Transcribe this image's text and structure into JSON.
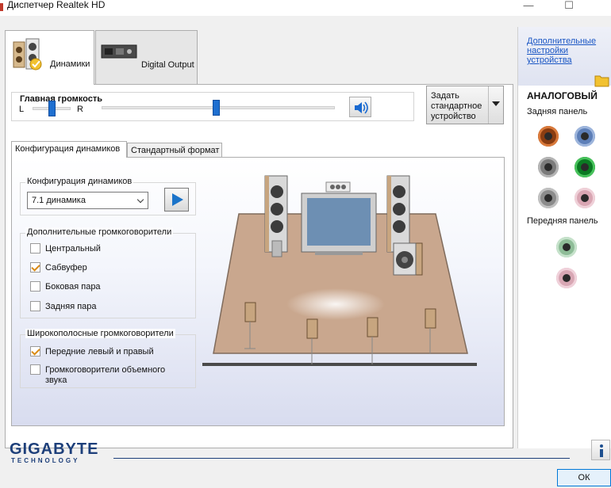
{
  "window": {
    "title": "Диспетчер Realtek HD",
    "minimize": "—",
    "maximize": "☐"
  },
  "device_tabs": [
    {
      "label": "Динамики",
      "active": true
    },
    {
      "label": "Digital Output",
      "active": false
    }
  ],
  "volume": {
    "title": "Главная громкость",
    "left": "L",
    "right": "R",
    "balance": 0.5,
    "level": 0.49
  },
  "default_device_button": "Задать стандартное устройство",
  "sub_tabs": [
    {
      "label": "Конфигурация динамиков",
      "active": true
    },
    {
      "label": "Стандартный формат",
      "active": false
    }
  ],
  "speaker_config": {
    "group_label": "Конфигурация динамиков",
    "selected": "7.1 динамика"
  },
  "extra_speakers": {
    "group_label": "Дополнительные громкоговорители",
    "items": [
      {
        "label": "Центральный",
        "checked": false
      },
      {
        "label": "Сабвуфер",
        "checked": true
      },
      {
        "label": "Боковая пара",
        "checked": false
      },
      {
        "label": "Задняя пара",
        "checked": false
      }
    ]
  },
  "fullrange": {
    "group_label": "Широкополосные громкоговорители",
    "items": [
      {
        "label": "Передние левый и правый",
        "checked": true
      },
      {
        "label": "Громкоговорители объемного звука",
        "checked": false
      }
    ]
  },
  "right_panel": {
    "link": "Дополнительные настройки устройства",
    "analog_title": "АНАЛОГОВЫЙ",
    "rear_panel": "Задняя панель",
    "front_panel": "Передняя панель"
  },
  "brand": {
    "name": "GIGABYTE",
    "sub": "TECHNOLOGY"
  },
  "ok_button": "ОК",
  "colors": {
    "accent": "#1e6fd0",
    "link": "#1a56c4",
    "room_floor": "#c9a78e",
    "check": "#d98a15"
  },
  "icons": [
    "speakers-icon",
    "digital-output-icon",
    "speaker-volume-icon",
    "play-icon",
    "folder-icon",
    "info-icon"
  ]
}
